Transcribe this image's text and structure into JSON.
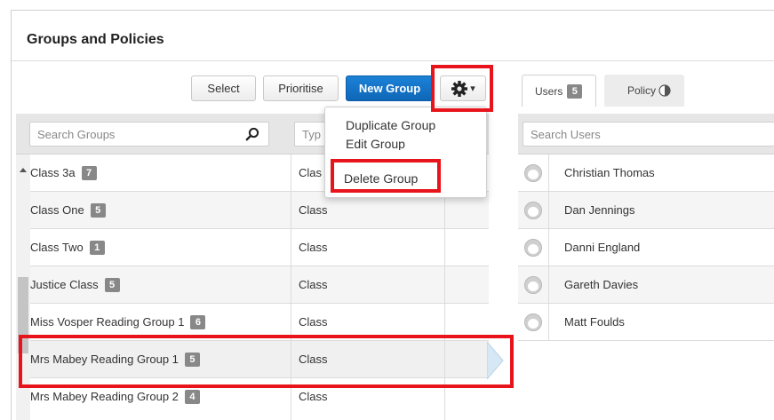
{
  "page": {
    "title": "Groups and Policies"
  },
  "toolbar": {
    "select_label": "Select",
    "prioritise_label": "Prioritise",
    "new_group_label": "New Group",
    "gear_caret": "▾"
  },
  "groups": {
    "search_placeholder": "Search Groups",
    "type_placeholder": "Typ",
    "rows": [
      {
        "name": "Class 3a",
        "count": "7",
        "type": "Clas"
      },
      {
        "name": "Class One",
        "count": "5",
        "type": "Class"
      },
      {
        "name": "Class Two",
        "count": "1",
        "type": "Class"
      },
      {
        "name": "Justice Class",
        "count": "5",
        "type": "Class"
      },
      {
        "name": "Miss Vosper Reading Group 1",
        "count": "6",
        "type": "Class"
      },
      {
        "name": "Mrs Mabey Reading Group 1",
        "count": "5",
        "type": "Class"
      },
      {
        "name": "Mrs Mabey Reading Group 2",
        "count": "4",
        "type": "Class"
      }
    ]
  },
  "menu": {
    "items": [
      "Duplicate Group",
      "Edit Group",
      "Delete Group"
    ]
  },
  "right_panel": {
    "tabs": [
      {
        "label": "Users",
        "count": "5"
      },
      {
        "label": "Policy"
      }
    ],
    "search_placeholder": "Search Users",
    "users": [
      "Christian Thomas",
      "Dan Jennings",
      "Danni England",
      "Gareth Davies",
      "Matt Foulds"
    ]
  },
  "colors": {
    "primary": "#1474c8",
    "highlight": "#e8141b",
    "badge": "#888888"
  }
}
